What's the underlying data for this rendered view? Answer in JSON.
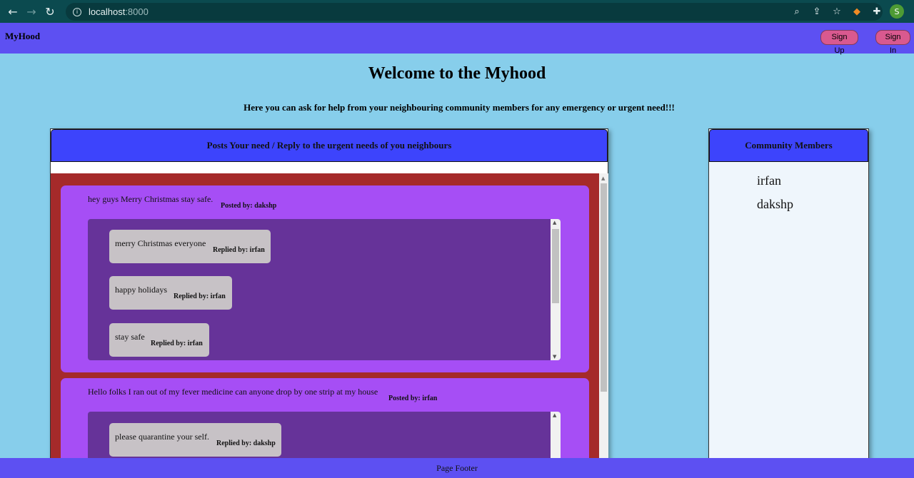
{
  "browser": {
    "url_host": "localhost",
    "url_port": ":8000",
    "profile_initial": "S"
  },
  "header": {
    "brand": "MyHood",
    "signup_label": "Sign Up",
    "signin_label": "Sign In"
  },
  "main": {
    "title": "Welcome to the Myhood",
    "subtitle": "Here you can ask for help from your neighbouring community members for any emergency or urgent need!!!"
  },
  "posts_panel": {
    "heading": "Posts Your need / Reply to the urgent needs of you neighbours",
    "posts": [
      {
        "text": "hey guys Merry Christmas stay safe.",
        "posted_by": "Posted by: dakshp",
        "replies": [
          {
            "text": "merry Christmas everyone",
            "by": "Replied by: irfan"
          },
          {
            "text": "happy holidays",
            "by": "Replied by: irfan"
          },
          {
            "text": "stay safe",
            "by": "Replied by: irfan"
          }
        ]
      },
      {
        "text": "Hello folks I ran out of my fever medicine can anyone drop by one strip at my house",
        "posted_by": "Posted by: irfan",
        "replies": [
          {
            "text": "please quarantine your self.",
            "by": "Replied by: dakshp"
          }
        ]
      }
    ]
  },
  "members_panel": {
    "heading": "Community Members",
    "members": [
      "irfan",
      "dakshp"
    ]
  },
  "footer": {
    "text": "Page Footer"
  }
}
